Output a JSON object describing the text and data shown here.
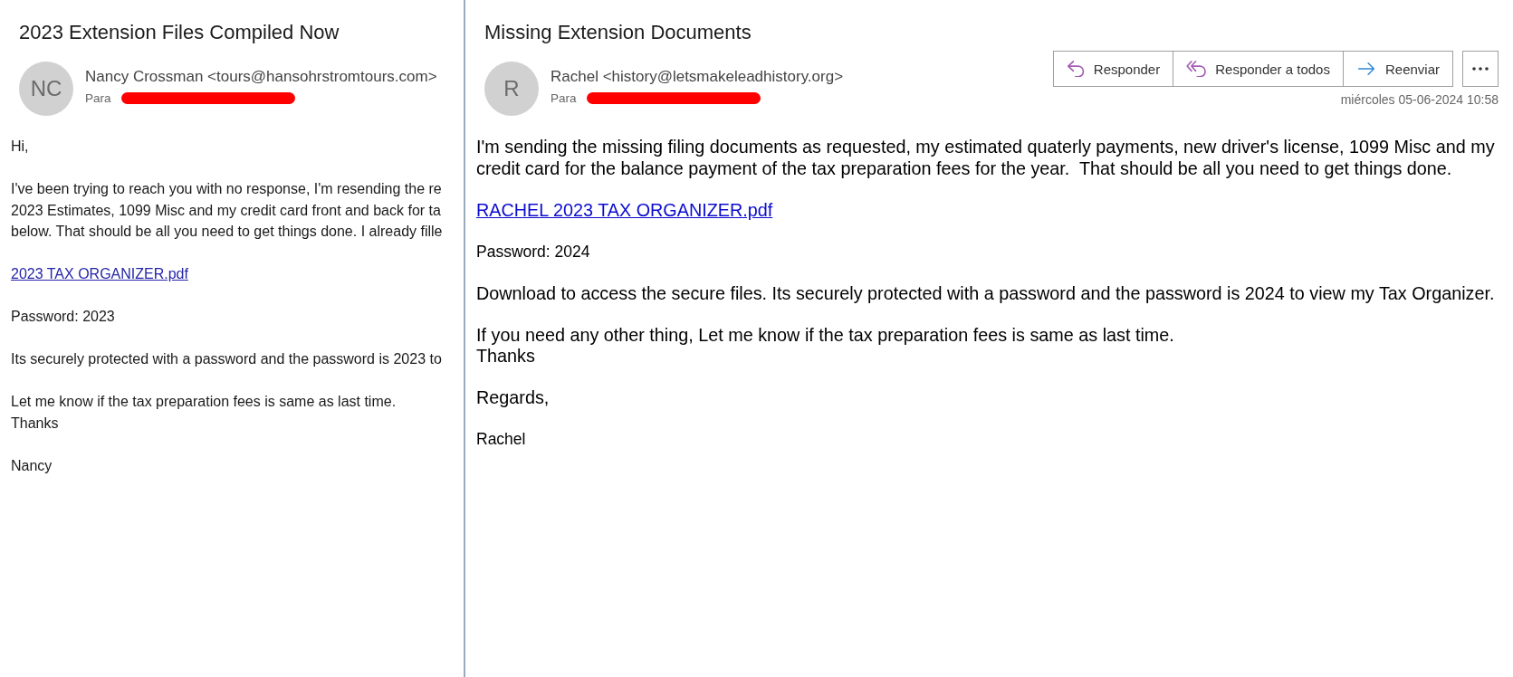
{
  "messages": [
    {
      "subject": "2023 Extension Files Compiled Now",
      "sender": {
        "initials": "NC",
        "name": "Nancy Crossman <tours@hansohrstromtours.com>",
        "to_label": "Para"
      },
      "body": [
        {
          "kind": "text",
          "lines": [
            "Hi,"
          ]
        },
        {
          "kind": "text",
          "lines": [
            "I've been trying to reach you with no response, I'm resending the re",
            "2023 Estimates, 1099 Misc and my credit card front and back for ta",
            "below. That should be all you need to get things done. I already fille"
          ]
        },
        {
          "kind": "link",
          "lines": [
            "2023 TAX ORGANIZER.pdf"
          ]
        },
        {
          "kind": "text",
          "lines": [
            "Password: 2023"
          ]
        },
        {
          "kind": "text",
          "lines": [
            "Its securely protected with a password and the password is 2023 to"
          ]
        },
        {
          "kind": "text",
          "lines": [
            "Let me know if the tax preparation fees is same as last time.",
            "Thanks"
          ]
        },
        {
          "kind": "text",
          "lines": [
            "Nancy"
          ]
        }
      ]
    },
    {
      "subject": "Missing Extension Documents",
      "sender": {
        "initials": "R",
        "name": "Rachel <history@letsmakeleadhistory.org>",
        "to_label": "Para"
      },
      "actions": [
        {
          "kind": "reply",
          "label": "Responder"
        },
        {
          "kind": "reply_all",
          "label": "Responder a todos"
        },
        {
          "kind": "forward",
          "label": "Reenviar"
        },
        {
          "kind": "more"
        }
      ],
      "date": "miércoles 05-06-2024 10:58",
      "body": [
        {
          "kind": "text",
          "lines": [
            "I'm sending the missing filing documents as requested, my estimated quaterly payments, new driver's license, 1099 Misc and my",
            "credit card for the balance payment of the tax preparation fees for the year.  That should be all you need to get things done."
          ]
        },
        {
          "kind": "link",
          "lines": [
            "RACHEL 2023 TAX ORGANIZER.pdf"
          ]
        },
        {
          "kind": "small",
          "lines": [
            "Password: 2024"
          ]
        },
        {
          "kind": "text",
          "lines": [
            "Download to access the secure files. Its securely protected with a password and the password is 2024 to view my Tax Organizer."
          ]
        },
        {
          "kind": "text",
          "lines": [
            "If you need any other thing, Let me know if the tax preparation fees is same as last time.",
            "Thanks"
          ]
        },
        {
          "kind": "text",
          "lines": [
            "Regards,"
          ]
        },
        {
          "kind": "small",
          "lines": [
            "Rachel"
          ]
        }
      ]
    }
  ]
}
